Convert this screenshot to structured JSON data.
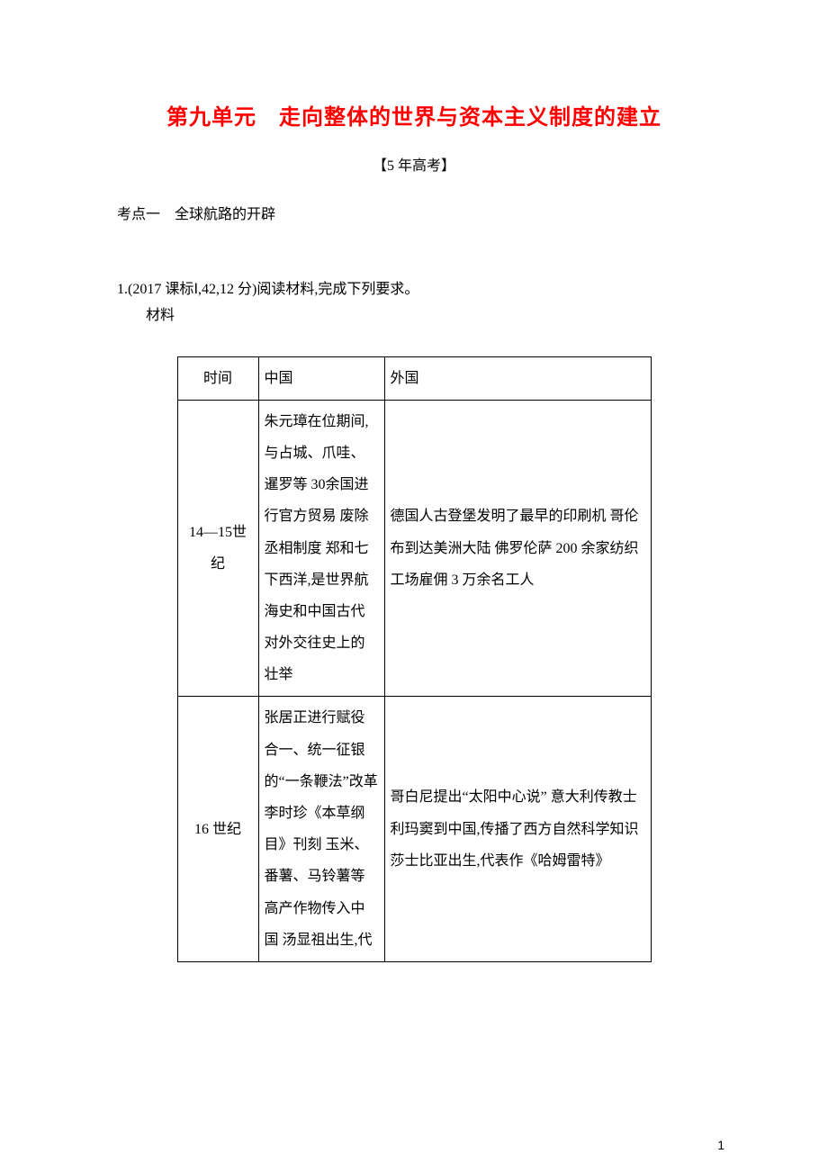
{
  "title": "第九单元　走向整体的世界与资本主义制度的建立",
  "subtitle": "【5 年高考】",
  "section_label": "考点一　全球航路的开辟",
  "question": {
    "number_line": "1.(2017 课标Ⅰ,42,12 分)阅读材料,完成下列要求。",
    "material_label": "材料"
  },
  "table": {
    "headers": {
      "time": "时间",
      "china": "中国",
      "foreign": "外国"
    },
    "rows": [
      {
        "time": "14—15世纪",
        "china": "朱元璋在位期间,与占城、爪哇、暹罗等 30余国进行官方贸易\n废除丞相制度\n郑和七下西洋,是世界航海史和中国古代对外交往史上的壮举",
        "foreign": "德国人古登堡发明了最早的印刷机\n哥伦布到达美洲大陆\n佛罗伦萨 200 余家纺织工场雇佣 3 万余名工人"
      },
      {
        "time": "16 世纪",
        "china": "张居正进行赋役合一、统一征银的“一条鞭法”改革\n李时珍《本草纲目》刊刻\n玉米、番薯、马铃薯等高产作物传入中国\n汤显祖出生,代",
        "foreign": "哥白尼提出“太阳中心说”\n意大利传教士利玛窦到中国,传播了西方自然科学知识\n莎士比亚出生,代表作《哈姆雷特》"
      }
    ]
  },
  "page_number": "1"
}
